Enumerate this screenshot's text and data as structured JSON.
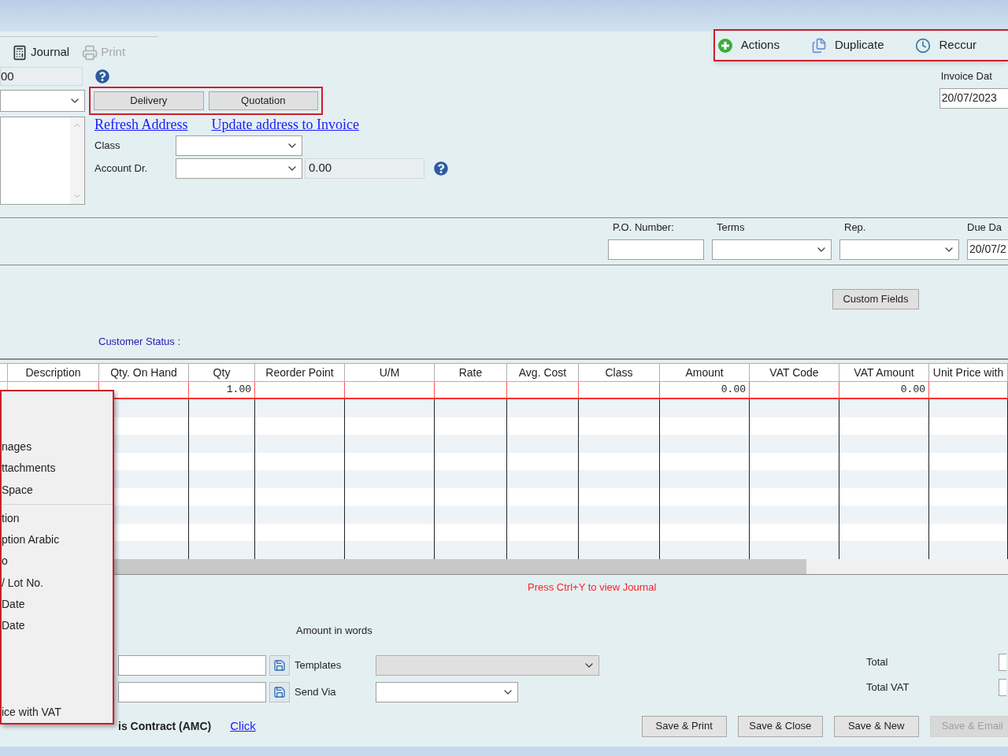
{
  "toolbar": {
    "left": [
      {
        "kind": "journal",
        "label": "Journal",
        "disabled": false
      },
      {
        "kind": "print",
        "label": "Print",
        "disabled": true
      }
    ],
    "right": [
      {
        "kind": "add",
        "label": "Actions"
      },
      {
        "kind": "copy",
        "label": "Duplicate"
      },
      {
        "kind": "clock",
        "label": "Reccur"
      }
    ]
  },
  "header": {
    "number_value": "00",
    "buttons": [
      "Delivery",
      "Quotation"
    ],
    "links": [
      "Refresh Address",
      "Update address to Invoice"
    ],
    "class_label": "Class",
    "account_label": "Account Dr.",
    "account_amount": "0.00",
    "invoice_date_label": "Invoice Dat",
    "invoice_date": "20/07/2023"
  },
  "details": [
    {
      "kind": "text",
      "label": "P.O. Number:"
    },
    {
      "kind": "select",
      "label": "Terms"
    },
    {
      "kind": "select",
      "label": "Rep."
    },
    {
      "kind": "date",
      "label": "Due Da",
      "value": "20/07/2"
    }
  ],
  "custom_fields_button": "Custom Fields",
  "customer_status": "Customer Status :",
  "table": {
    "columns": [
      "Description",
      "Qty. On Hand",
      "Qty",
      "Reorder Point",
      "U/M",
      "Rate",
      "Avg. Cost",
      "Class",
      "Amount",
      "VAT Code",
      "VAT Amount",
      "Unit Price with"
    ],
    "rows": [
      {
        "cells": [
          "",
          "",
          "1.00",
          "",
          "",
          "",
          "",
          "",
          "0.00",
          "",
          "0.00",
          ""
        ]
      }
    ]
  },
  "context_menu": [
    {
      "kind": "blank"
    },
    {
      "kind": "blank"
    },
    {
      "kind": "item",
      "label": "nages"
    },
    {
      "kind": "item",
      "label": "ttachments"
    },
    {
      "kind": "item",
      "label": "Space"
    },
    {
      "kind": "separator"
    },
    {
      "kind": "item",
      "label": "tion"
    },
    {
      "kind": "item",
      "label": "ption Arabic"
    },
    {
      "kind": "item",
      "label": "o"
    },
    {
      "kind": "item",
      "label": "/ Lot No."
    },
    {
      "kind": "item",
      "label": "Date"
    },
    {
      "kind": "item",
      "label": "Date"
    },
    {
      "kind": "blank"
    },
    {
      "kind": "blank"
    },
    {
      "kind": "blank"
    },
    {
      "kind": "item",
      "label": "ice with VAT"
    }
  ],
  "journal_hint": "Press Ctrl+Y to view Journal",
  "amount_in_words_label": "Amount in words",
  "templates": {
    "label": "Templates",
    "disabled": true
  },
  "send_via": {
    "label": "Send Via",
    "disabled": false
  },
  "totals": [
    {
      "label": "Total"
    },
    {
      "label": "Total VAT"
    }
  ],
  "contract": {
    "label": "is Contract (AMC)",
    "link": "Click"
  },
  "footer_buttons": [
    {
      "label": "Save & Print",
      "disabled": false
    },
    {
      "label": "Save & Close",
      "disabled": false
    },
    {
      "label": "Save & New",
      "disabled": false
    },
    {
      "label": "Save & Email",
      "disabled": true
    }
  ]
}
